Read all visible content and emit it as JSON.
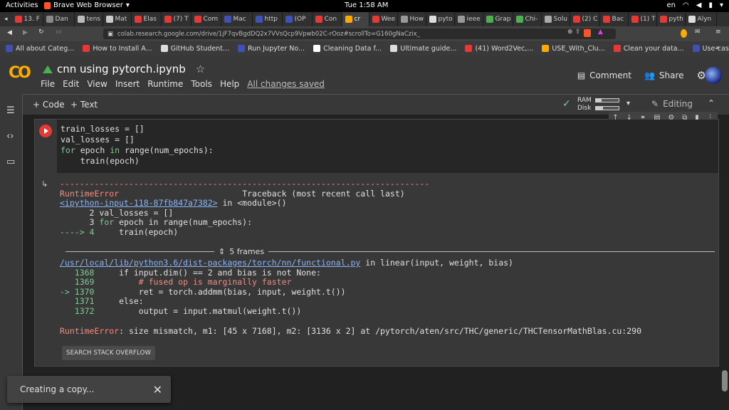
{
  "system_bar": {
    "activities": "Activities",
    "app_name": "Brave Web Browser",
    "clock": "Tue 1:58 AM",
    "lang": "en"
  },
  "tabs": [
    {
      "label": "13. F",
      "color": "#e53935"
    },
    {
      "label": "Dan",
      "color": "#888"
    },
    {
      "label": "tens",
      "color": "#bbb"
    },
    {
      "label": "Mat",
      "color": "#ccc"
    },
    {
      "label": "Elas",
      "color": "#e53935"
    },
    {
      "label": "(7) T",
      "color": "#e53935"
    },
    {
      "label": "Com",
      "color": "#e53935"
    },
    {
      "label": "Mac",
      "color": "#3f51b5"
    },
    {
      "label": "http",
      "color": "#3f51b5"
    },
    {
      "label": "(OP",
      "color": "#3f51b5"
    },
    {
      "label": "Con",
      "color": "#e53935"
    },
    {
      "label": "cr",
      "color": "#f9ab00",
      "active": true
    },
    {
      "label": "Wee",
      "color": "#e53935"
    },
    {
      "label": "How",
      "color": "#999"
    },
    {
      "label": "pyto",
      "color": "#ddd"
    },
    {
      "label": "ieee",
      "color": "#999"
    },
    {
      "label": "Grap",
      "color": "#4caf50"
    },
    {
      "label": "Chi-",
      "color": "#4caf50"
    },
    {
      "label": "Solu",
      "color": "#aaa"
    },
    {
      "label": "(2) C",
      "color": "#e53935"
    },
    {
      "label": "Bac",
      "color": "#e53935"
    },
    {
      "label": "(1) T",
      "color": "#e53935"
    },
    {
      "label": "pyth",
      "color": "#e53935"
    },
    {
      "label": "Alyn",
      "color": "#ddd"
    }
  ],
  "address": {
    "url": "colab.research.google.com/drive/1jF7qvBgdDQ2x7VVsQcp9Vpwb02C-rOoz#scrollTo=G160gNaCzix_"
  },
  "bookmarks": [
    {
      "label": "All about Categ...",
      "color": "#3f51b5"
    },
    {
      "label": "How to Install A...",
      "color": "#e53935"
    },
    {
      "label": "GitHub Student...",
      "color": "#ddd"
    },
    {
      "label": "Run Jupyter No...",
      "color": "#3f51b5"
    },
    {
      "label": "Cleaning Data f...",
      "color": "#fff"
    },
    {
      "label": "Ultimate guide...",
      "color": "#ddd"
    },
    {
      "label": "(41) Word2Vec,...",
      "color": "#e53935"
    },
    {
      "label": "USE_With_Clu...",
      "color": "#f9ab00"
    },
    {
      "label": "Clean your data...",
      "color": "#e53935"
    },
    {
      "label": "Use-cases of G...",
      "color": "#3f51b5"
    }
  ],
  "notebook": {
    "logo": "CO",
    "title": "cnn using pytorch.ipynb",
    "menu": [
      "File",
      "Edit",
      "View",
      "Insert",
      "Runtime",
      "Tools",
      "Help"
    ],
    "save_status": "All changes saved",
    "comment": "Comment",
    "share": "Share"
  },
  "toolbar": {
    "add_code": "+ Code",
    "add_text": "+ Text",
    "ram": "RAM",
    "disk": "Disk",
    "editing": "Editing"
  },
  "code": {
    "line1": "train_losses = []",
    "line2": "val_losses = []",
    "line3_kw": "for",
    "line3_a": " epoch ",
    "line3_in": "in",
    "line3_b": " range(num_epochs):",
    "line4": "    train(epoch)"
  },
  "output": {
    "dashes": "---------------------------------------------------------------------------",
    "err_type": "RuntimeError",
    "traceback": "Traceback (most recent call last)",
    "input_link": "<ipython-input-118-87fb847a7382>",
    "in_module": " in <module>()",
    "l2": "      2 val_losses = []",
    "l3_pre": "      3 ",
    "l3_for": "for",
    "l3_rest": " epoch in range(num_epochs):",
    "l4_arrow": "----> 4",
    "l4_rest": "     train(epoch)",
    "frames": "5 frames",
    "file_link": "/usr/local/lib/python3.6/dist-packages/torch/nn/functional.py",
    "in_linear": " in linear(input, weight, bias)",
    "f1368_no": "   1368",
    "f1368": "     if input.dim() == 2 and bias is not None:",
    "f1369_no": "   1369",
    "f1369": "         # fused op is marginally faster",
    "f1370_no": "-> 1370",
    "f1370": "         ret = torch.addmm(bias, input, weight.t())",
    "f1371_no": "   1371",
    "f1371": "     else:",
    "f1372_no": "   1372",
    "f1372": "         output = input.matmul(weight.t())",
    "final_err": "RuntimeError",
    "final_msg": ": size mismatch, m1: [45 x 7168], m2: [3136 x 2] at /pytorch/aten/src/THC/generic/THCTensorMathBlas.cu:290",
    "so_button": "SEARCH STACK OVERFLOW"
  },
  "toast": {
    "message": "Creating a copy..."
  },
  "colors": {
    "accent": "#f9ab00",
    "error": "#f28b82",
    "link": "#8ab4f8",
    "ok": "#81c995"
  }
}
